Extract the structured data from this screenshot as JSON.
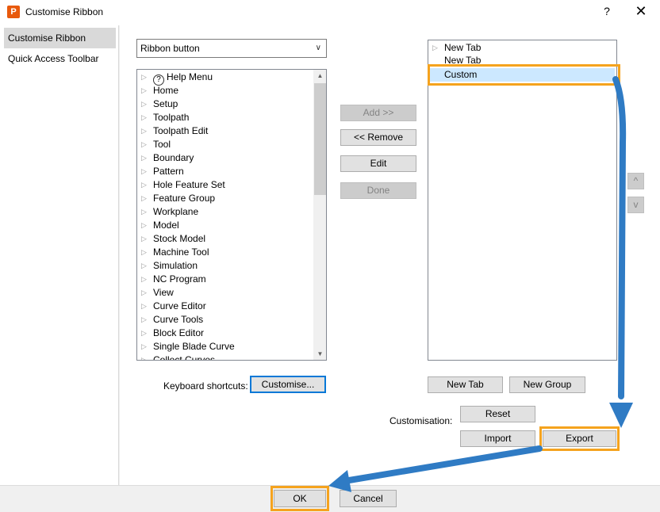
{
  "window": {
    "title": "Customise Ribbon",
    "app_icon_letter": "P",
    "help_label": "?",
    "close_label": "✕"
  },
  "sidebar": {
    "items": [
      {
        "label": "Customise Ribbon"
      },
      {
        "label": "Quick Access Toolbar"
      }
    ]
  },
  "source": {
    "dropdown_value": "Ribbon button",
    "items": [
      "Help Menu",
      "Home",
      "Setup",
      "Toolpath",
      "Toolpath Edit",
      "Tool",
      "Boundary",
      "Pattern",
      "Hole Feature Set",
      "Feature Group",
      "Workplane",
      "Model",
      "Stock Model",
      "Machine Tool",
      "Simulation",
      "NC Program",
      "View",
      "Curve Editor",
      "Curve Tools",
      "Block Editor",
      "Single Blade Curve",
      "Collect Curves"
    ]
  },
  "actions": {
    "add": "Add >>",
    "remove": "<< Remove",
    "edit": "Edit",
    "done": "Done"
  },
  "target": {
    "items": [
      "New Tab",
      "New Tab",
      "Custom"
    ],
    "move_up": "^",
    "move_down": "v",
    "new_tab": "New Tab",
    "new_group": "New Group"
  },
  "keyboard": {
    "label": "Keyboard shortcuts:",
    "button": "Customise..."
  },
  "customisation": {
    "label": "Customisation:",
    "reset": "Reset",
    "import": "Import",
    "export": "Export"
  },
  "footer": {
    "ok": "OK",
    "cancel": "Cancel"
  },
  "colors": {
    "highlight": "#f5a31e",
    "arrow": "#2f7bc4",
    "selection": "#cce8ff"
  }
}
